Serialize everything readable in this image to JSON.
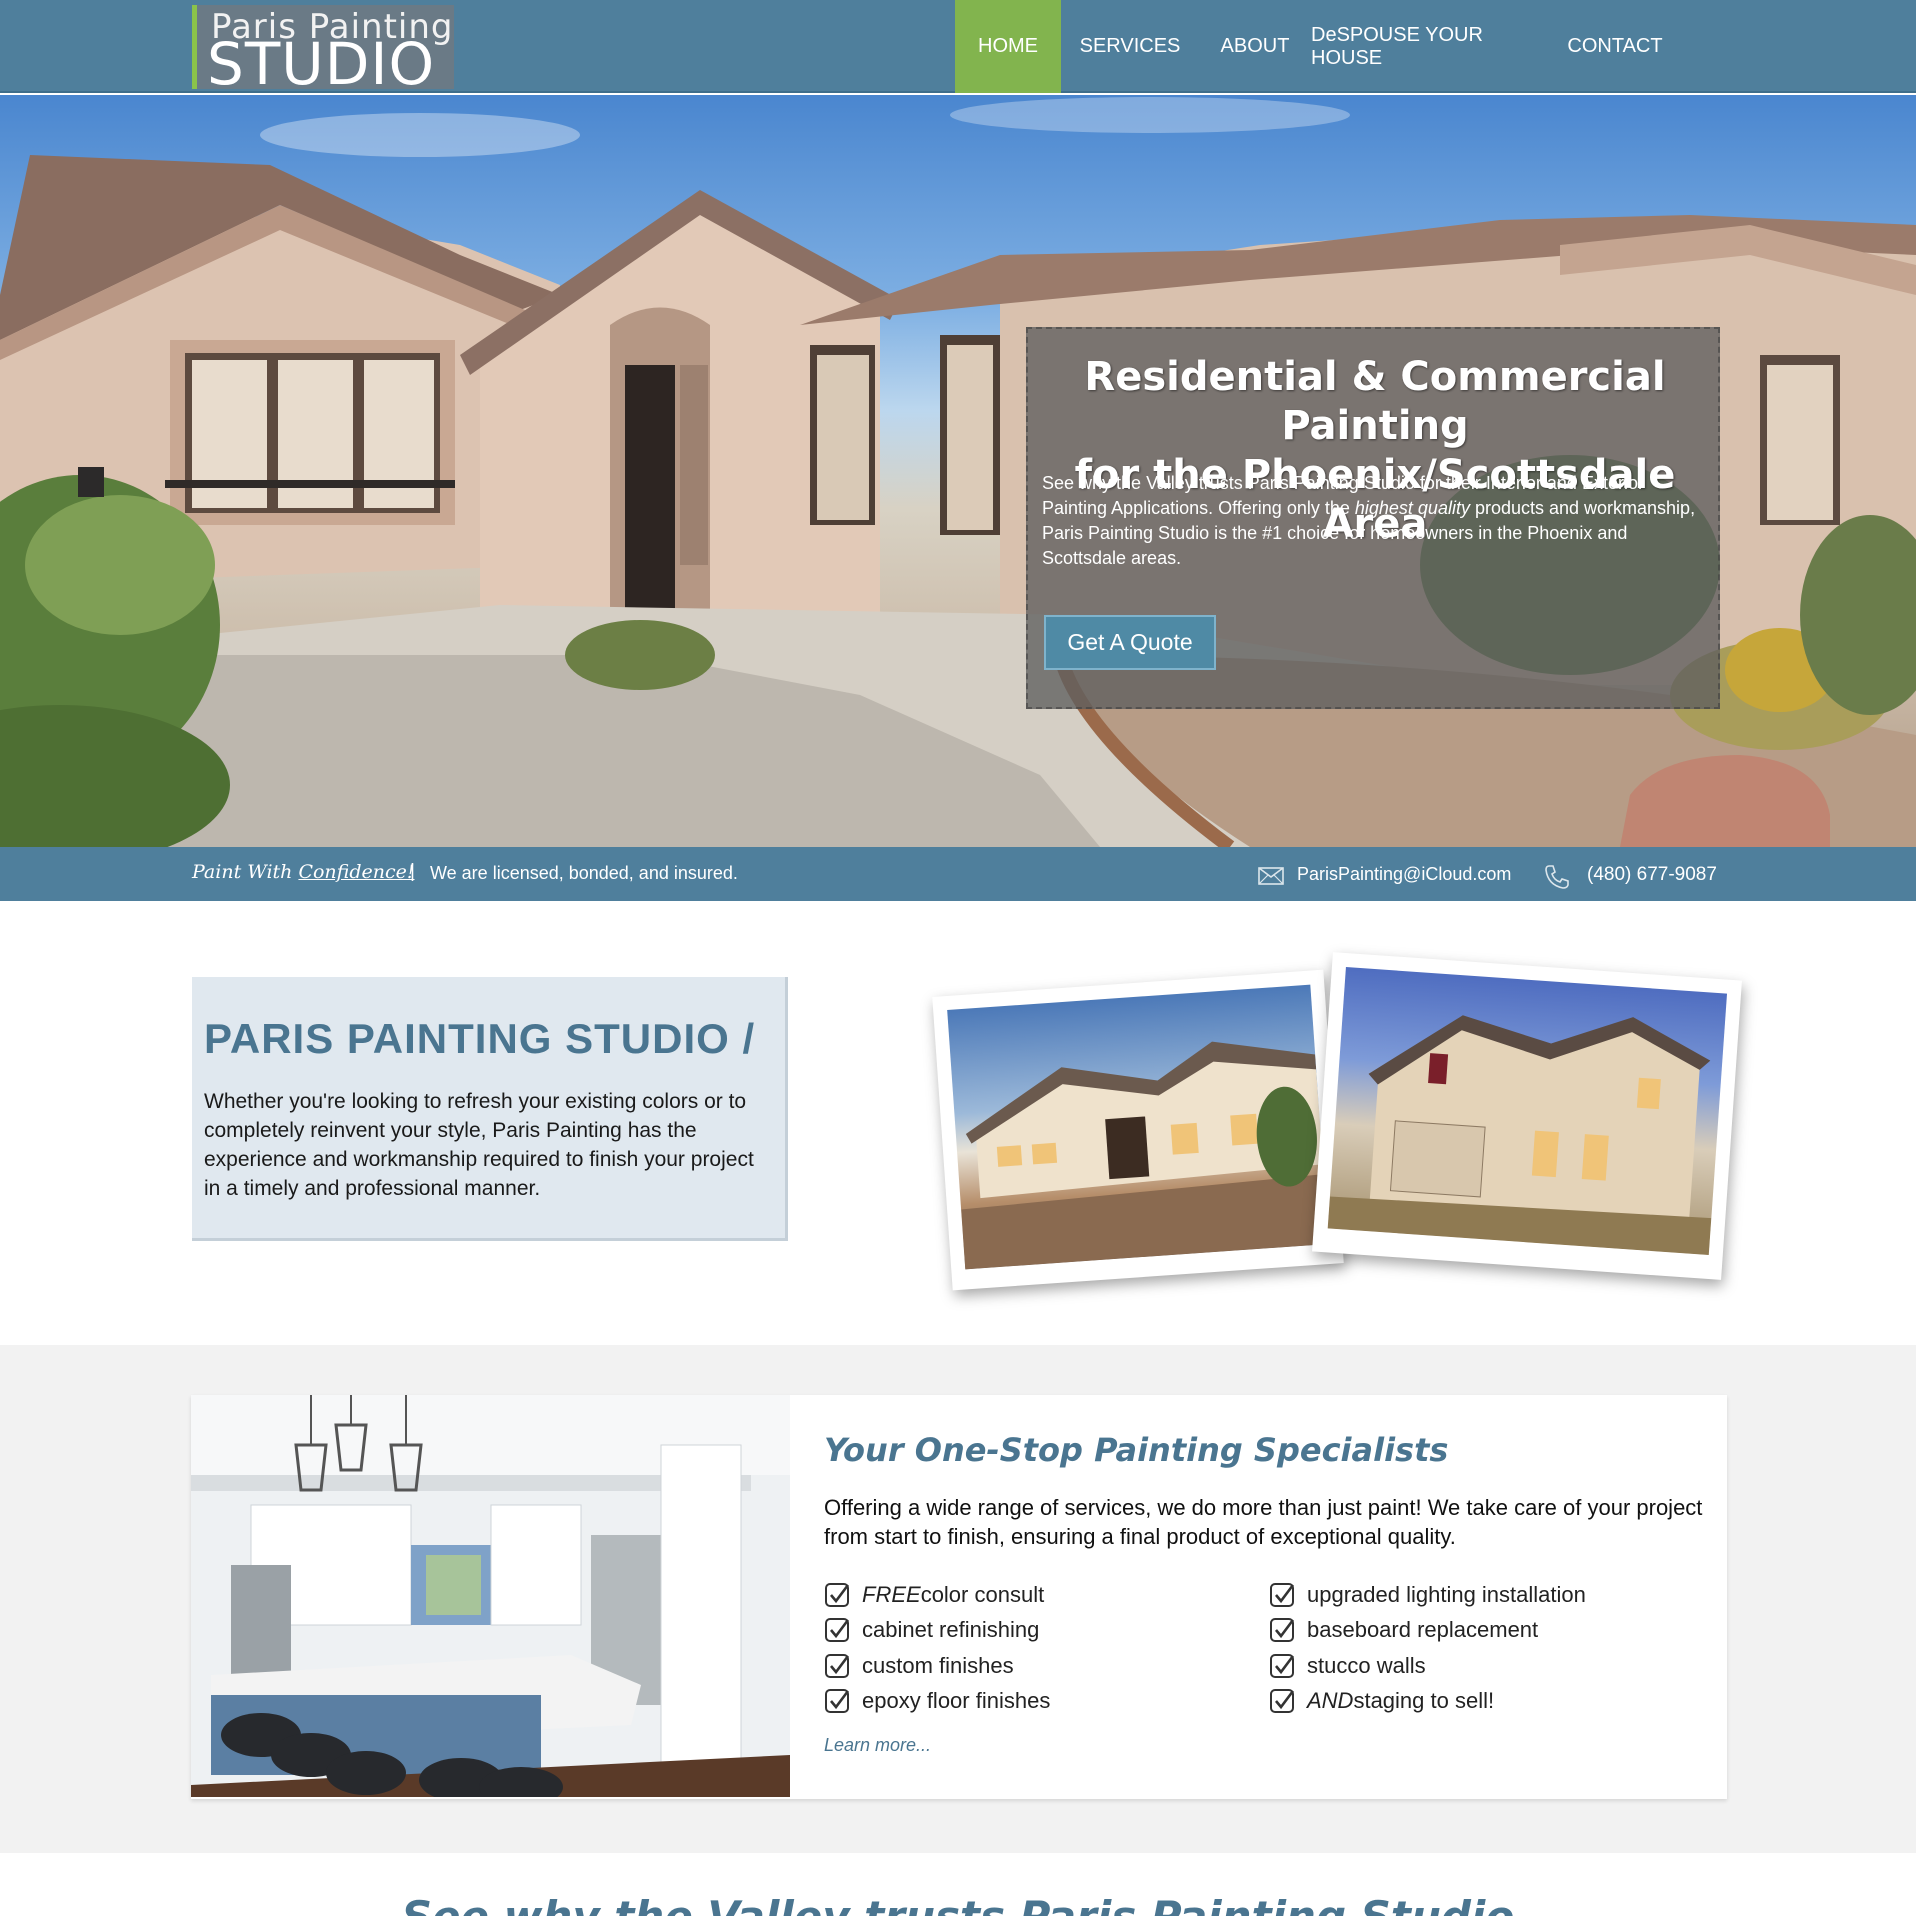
{
  "header": {
    "logo_top": "Paris Painting",
    "logo_bottom": "STUDIO",
    "nav": [
      {
        "label": "HOME",
        "active": true
      },
      {
        "label": "SERVICES",
        "active": false
      },
      {
        "label": "ABOUT",
        "active": false
      },
      {
        "label": "DeSPOUSE YOUR HOUSE",
        "active": false
      },
      {
        "label": "CONTACT",
        "active": false
      }
    ]
  },
  "hero": {
    "title_line1": "Residential & Commercial Painting",
    "title_line2": "for the Phoenix/Scottsdale Area",
    "text_part1": "See why the Valley trusts Paris Painting Studio for their Interior and Exterior Painting Applications. Offering only the ",
    "text_emphasis": "highest quality",
    "text_part2": " products and workmanship, Paris Painting Studio is the #1 choice for homeowners in the Phoenix and Scottsdale areas.",
    "button": "Get A Quote"
  },
  "infobar": {
    "tagline_part1": "Paint With ",
    "tagline_link": "Confidence!",
    "separator": "|",
    "licensed": "We are licensed, bonded, and insured.",
    "email": "ParisPainting@iCloud.com",
    "phone": "(480) 677-9087",
    "email_icon": "envelope-icon",
    "phone_icon": "phone-icon"
  },
  "about": {
    "title": "PARIS PAINTING STUDIO /",
    "text": "Whether you're looking to refresh your existing colors or to completely reinvent your style, Paris Painting has the experience and workmanship required to finish your project in a timely and professional manner."
  },
  "services": {
    "title": "Your One-Stop Painting Specialists",
    "text": "Offering a wide range of services, we do more than just paint! We take care of your project from start to finish, ensuring a final product of exceptional quality.",
    "left_items": [
      {
        "em": "FREE",
        "text": " color consult"
      },
      {
        "em": "",
        "text": "cabinet refinishing"
      },
      {
        "em": "",
        "text": "custom finishes"
      },
      {
        "em": "",
        "text": "epoxy floor finishes"
      }
    ],
    "right_items": [
      {
        "em": "",
        "text": "upgraded lighting installation"
      },
      {
        "em": "",
        "text": "baseboard replacement"
      },
      {
        "em": "",
        "text": "stucco walls"
      },
      {
        "em": "AND",
        "text": " staging to sell!"
      }
    ],
    "learn_more": "Learn more..."
  },
  "bottom": {
    "heading": "See why the Valley trusts Paris Painting Studio"
  },
  "colors": {
    "header_bg": "#4f7f9c",
    "nav_active": "#82b44e",
    "heading_blue": "#4a7590",
    "about_bg": "#e0e8ef",
    "band_bg": "#f2f2f2"
  }
}
